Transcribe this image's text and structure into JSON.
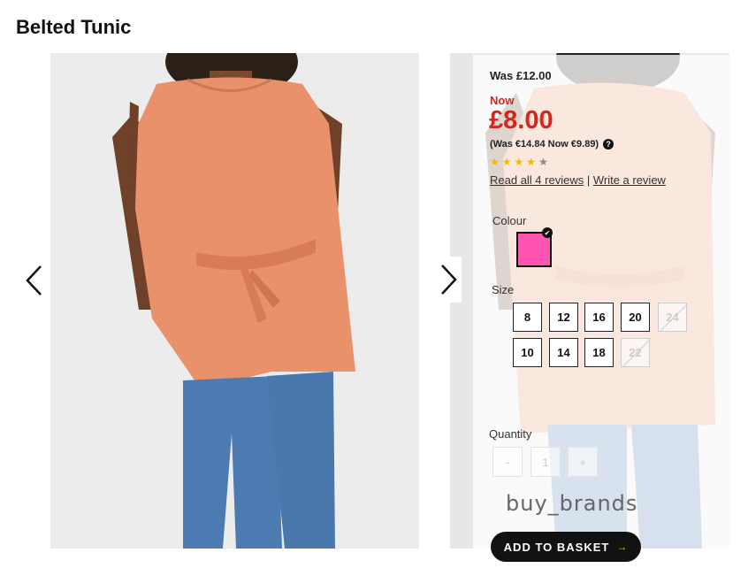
{
  "product": {
    "title": "Belted Tunic"
  },
  "gallery": {
    "prev_icon": "chevron-left-icon",
    "next_icon": "chevron-right-icon"
  },
  "pricing": {
    "was": "Was £12.00",
    "now_label": "Now",
    "price": "£8.00",
    "conversion": "(Was €14.84 Now €9.89)",
    "help_icon": "?"
  },
  "rating": {
    "stars": [
      "★",
      "★",
      "★",
      "★",
      "★"
    ],
    "filled": 4,
    "star_color": "#f5b800",
    "empty_color": "#888888",
    "read_reviews": "Read all 4 reviews",
    "separator": " | ",
    "write_review": "Write a review"
  },
  "colour": {
    "label": "Colour",
    "selected_color": "#ff55b0",
    "check": "✔"
  },
  "size": {
    "label": "Size",
    "row1": [
      "8",
      "12",
      "16",
      "20",
      "24"
    ],
    "row2": [
      "10",
      "14",
      "18",
      "22"
    ]
  },
  "quantity": {
    "label": "Quantity",
    "minus": "-",
    "value": "1",
    "plus": "+"
  },
  "watermark": "buy_brands",
  "cta": {
    "label": "ADD TO BASKET",
    "arrow": "→"
  }
}
